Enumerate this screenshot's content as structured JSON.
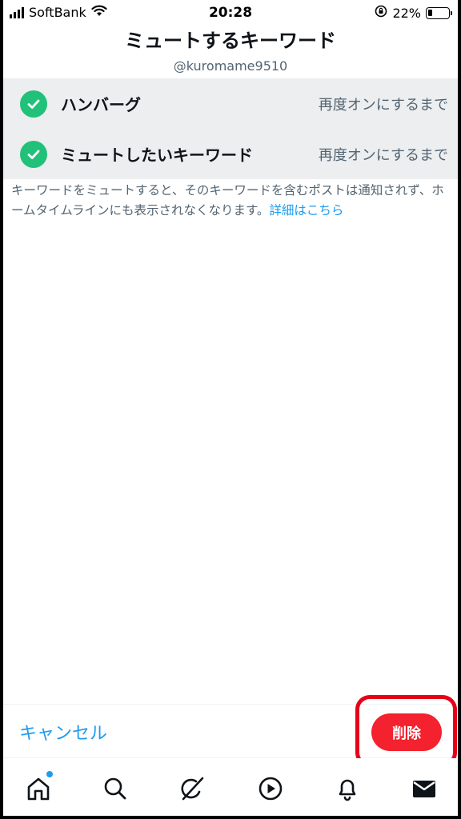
{
  "status_bar": {
    "carrier": "SoftBank",
    "time": "20:28",
    "battery": "22%",
    "icons": [
      "signal-icon",
      "wifi-icon",
      "orientation-lock-icon",
      "battery-icon"
    ]
  },
  "header": {
    "title": "ミュートするキーワード",
    "account": "@kuromame9510"
  },
  "muted_keywords": [
    {
      "keyword": "ハンバーグ",
      "duration": "再度オンにするまで",
      "checked": true
    },
    {
      "keyword": "ミュートしたいキーワード",
      "duration": "再度オンにするまで",
      "checked": true
    }
  ],
  "note": {
    "text": "キーワードをミュートすると、そのキーワードを含むポストは通知されず、ホームタイムラインにも表示されなくなります。",
    "link": "詳細はこちら"
  },
  "actions": {
    "cancel_label": "キャンセル",
    "delete_label": "削除"
  },
  "tabs": [
    "home-icon",
    "search-icon",
    "grok-icon",
    "video-icon",
    "notifications-icon",
    "messages-icon"
  ],
  "colors": {
    "accent": "#1d9bf0",
    "check": "#21c17a",
    "danger": "#f4212e",
    "highlight": "#e6001a"
  }
}
